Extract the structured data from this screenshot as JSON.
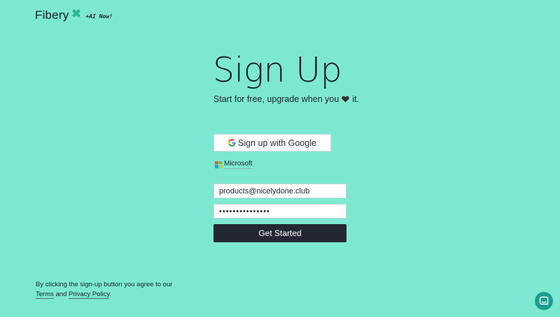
{
  "brand": {
    "name": "Fibery",
    "tagline": "+AI Now!",
    "mark_color": "#2bb596"
  },
  "page": {
    "title": "Sign Up",
    "subtitle_before": "Start for free, upgrade when you",
    "subtitle_after": "it.",
    "heart_icon": "heart-icon",
    "background": "#7de8d2"
  },
  "auth": {
    "google_label": "Sign up with Google",
    "microsoft_label": "Microsoft"
  },
  "form": {
    "email_value": "products@nicelydone.club",
    "password_value": "•••••••••••••••",
    "submit_label": "Get Started"
  },
  "legal": {
    "text_before": "By clicking the sign-up button you agree to our",
    "terms_label": "Terms",
    "and_text": "and",
    "privacy_label": "Privacy Policy",
    "period": "."
  },
  "chat": {
    "icon": "chat-icon",
    "color": "#1a9e8e"
  }
}
